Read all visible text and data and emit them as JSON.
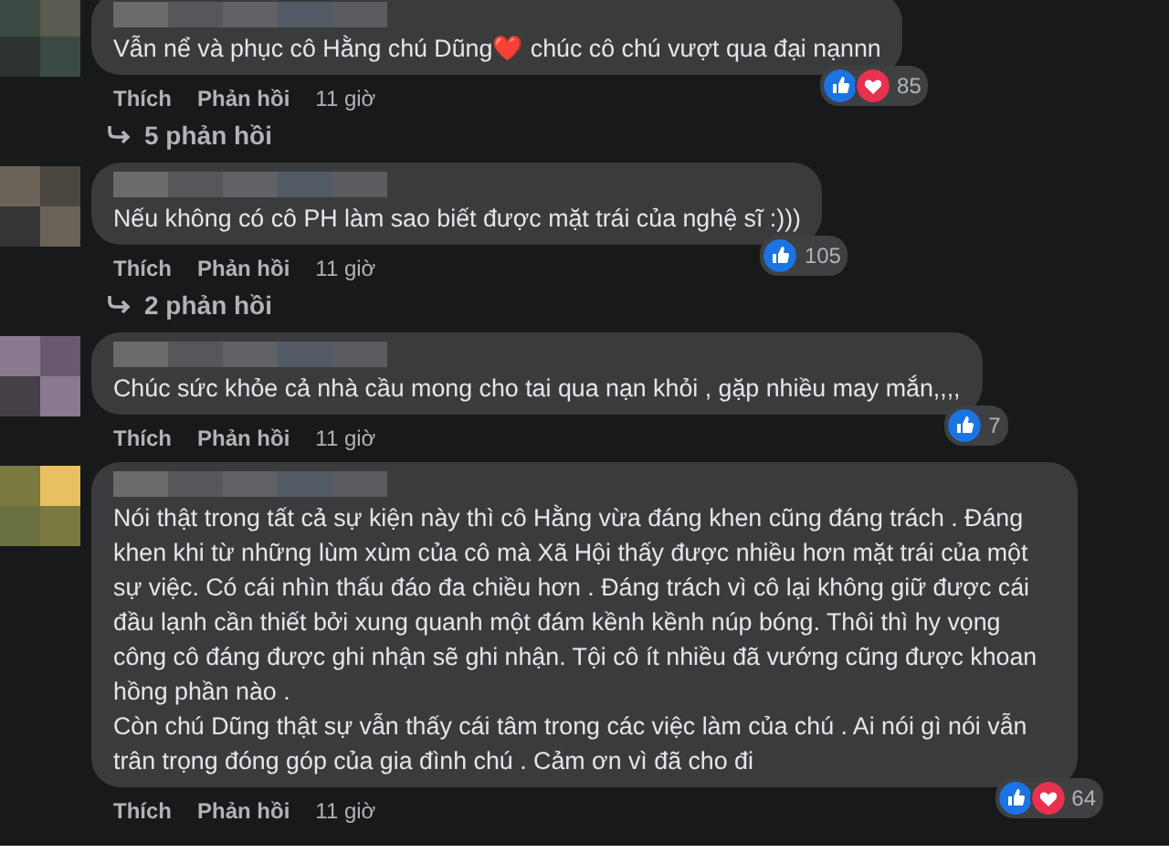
{
  "comments": [
    {
      "text": "Vẫn nể và phục cô Hằng chú Dũng❤️ chúc cô chú vượt qua đại nạnnn",
      "reactions": [
        {
          "kind": "like"
        },
        {
          "kind": "love"
        }
      ],
      "reaction_count": "85",
      "actions": [
        "Thích",
        "Phản hồi"
      ],
      "time": "11 giờ",
      "replies": "5 phản hồi"
    },
    {
      "text": "Nếu không có cô PH làm sao biết được mặt trái của nghệ sĩ :)))",
      "reactions": [
        {
          "kind": "like"
        }
      ],
      "reaction_count": "105",
      "actions": [
        "Thích",
        "Phản hồi"
      ],
      "time": "11 giờ",
      "replies": "2 phản hồi"
    },
    {
      "text": "Chúc sức khỏe cả nhà cầu mong cho tai qua nạn khỏi , gặp nhiều may mắn,,,,",
      "reactions": [
        {
          "kind": "like"
        }
      ],
      "reaction_count": "7",
      "actions": [
        "Thích",
        "Phản hồi"
      ],
      "time": "11 giờ"
    },
    {
      "text": "Nói thật trong tất cả sự kiện này thì cô Hằng vừa đáng khen cũng đáng trách . Đáng khen khi từ những lùm xùm của cô mà Xã Hội thấy được nhiều hơn mặt trái của một sự việc. Có cái nhìn thấu đáo đa chiều hơn . Đáng trách vì cô lại không giữ được cái đầu lạnh cần thiết bởi xung quanh một đám kềnh kềnh núp bóng. Thôi thì hy vọng công cô đáng được ghi nhận sẽ ghi nhận. Tội cô ít nhiều đã vướng cũng được khoan hồng phần nào .\nCòn chú Dũng thật sự vẫn thấy cái tâm trong các việc làm của chú . Ai nói gì nói vẫn trân trọng đóng góp của gia đình chú . Cảm ơn vì đã cho đi",
      "reactions": [
        {
          "kind": "like"
        },
        {
          "kind": "love"
        }
      ],
      "reaction_count": "64",
      "actions": [
        "Thích",
        "Phản hồi"
      ],
      "time": "11 giờ"
    }
  ]
}
